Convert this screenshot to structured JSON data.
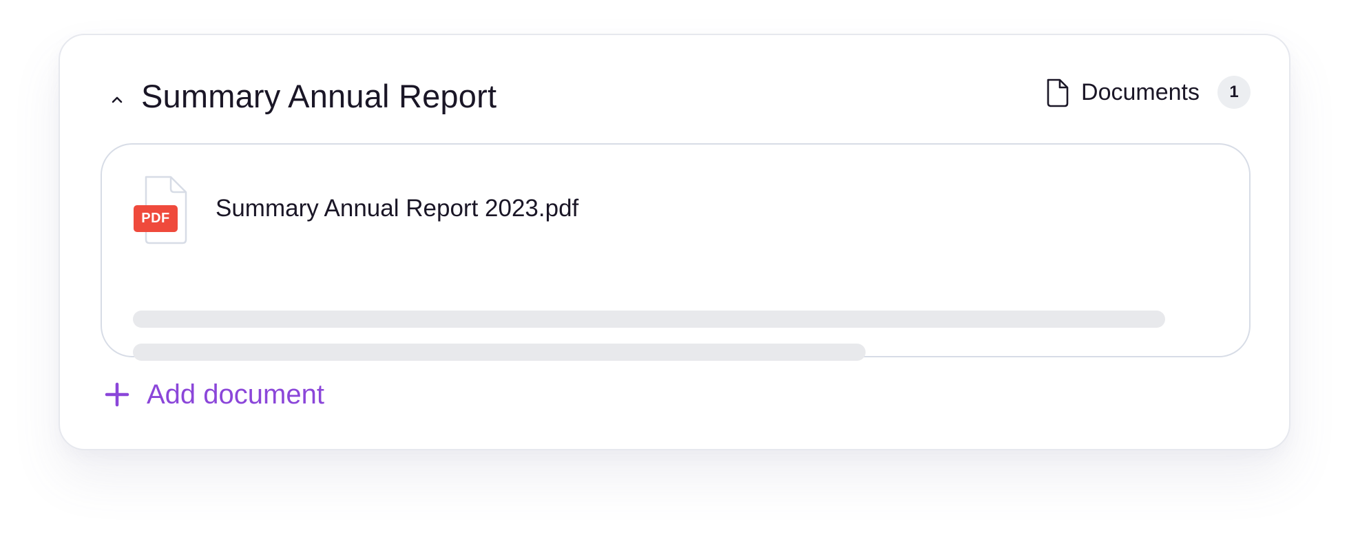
{
  "section": {
    "title": "Summary Annual Report",
    "expanded": true,
    "collapse_icon": "chevron-up-icon"
  },
  "documents_indicator": {
    "label": "Documents",
    "count": "1",
    "icon": "document-icon"
  },
  "document": {
    "file_name": "Summary Annual Report 2023.pdf",
    "badge": "PDF",
    "icon": "pdf-file-icon",
    "preview_loading": true
  },
  "add_document": {
    "label": "Add document",
    "icon": "plus-icon"
  },
  "colors": {
    "accent": "#8b46d9",
    "pdf_badge": "#ef4a3c",
    "text": "#1a1626",
    "border": "#d7dce6",
    "skeleton": "#e8e9ec",
    "count_badge_bg": "#eceef1"
  }
}
